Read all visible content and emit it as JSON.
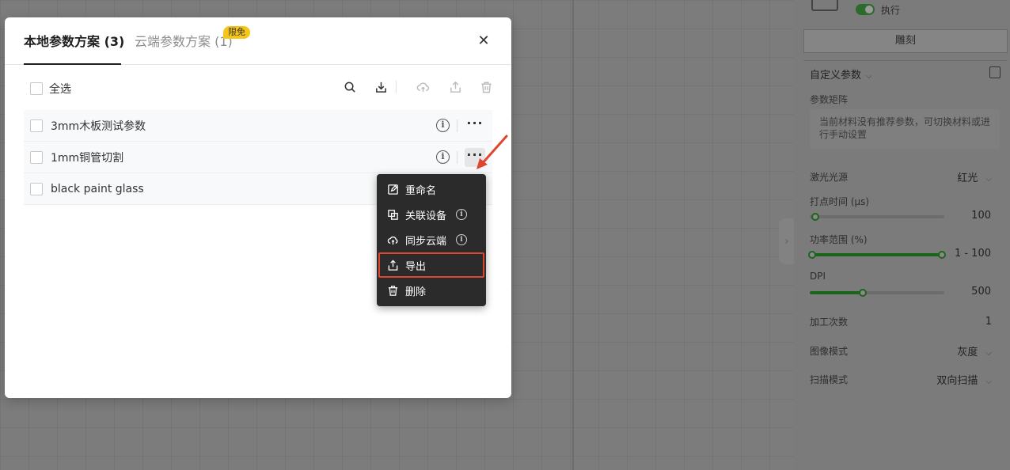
{
  "modal": {
    "tabs": {
      "local_label": "本地参数方案 (3)",
      "cloud_label": "云端参数方案 (1)",
      "cloud_badge": "限免"
    },
    "close_glyph": "✕",
    "toolbar": {
      "select_all_label": "全选"
    },
    "rows": [
      {
        "name": "3mm木板测试参数",
        "info_glyph": "i",
        "more_glyph": "···",
        "has_actions": true
      },
      {
        "name": "1mm铜管切割",
        "info_glyph": "i",
        "more_glyph": "···",
        "has_actions": true
      },
      {
        "name": "black paint glass"
      }
    ],
    "context_menu": {
      "items": [
        {
          "label": "重命名",
          "icon": "edit-icon"
        },
        {
          "label": "关联设备",
          "icon": "link-device-icon",
          "info": "i"
        },
        {
          "label": "同步云端",
          "icon": "cloud-sync-icon",
          "info": "i"
        },
        {
          "label": "导出",
          "icon": "export-icon",
          "highlighted": true
        },
        {
          "label": "删除",
          "icon": "trash-icon"
        }
      ]
    }
  },
  "right_panel": {
    "execute_label": "执行",
    "engrave_tab": "雕刻",
    "custom_params_label": "自定义参数",
    "matrix_label": "参数矩阵",
    "hint_text": "当前材料没有推荐参数，可切换材料或进行手动设置",
    "laser_source": {
      "label": "激光光源",
      "value": "红光"
    },
    "dot_time": {
      "label": "打点时间 (µs)",
      "value": "100",
      "level": 0.0
    },
    "power_range": {
      "label": "功率范围 (%)",
      "value": "1  - 100",
      "min": 1,
      "max": 100
    },
    "dpi": {
      "label": "DPI",
      "value": "500",
      "level": 0.4
    },
    "passes": {
      "label": "加工次数",
      "value": "1"
    },
    "image_mode": {
      "label": "图像模式",
      "value": "灰度"
    },
    "scan_mode": {
      "label": "扫描模式",
      "value": "双向扫描"
    },
    "collapse_glyph": "›"
  },
  "colors": {
    "accent_green": "#1c641c",
    "highlight_red": "#e0452f",
    "badge_yellow": "#f5c518",
    "menu_bg": "#2b2b2b"
  }
}
